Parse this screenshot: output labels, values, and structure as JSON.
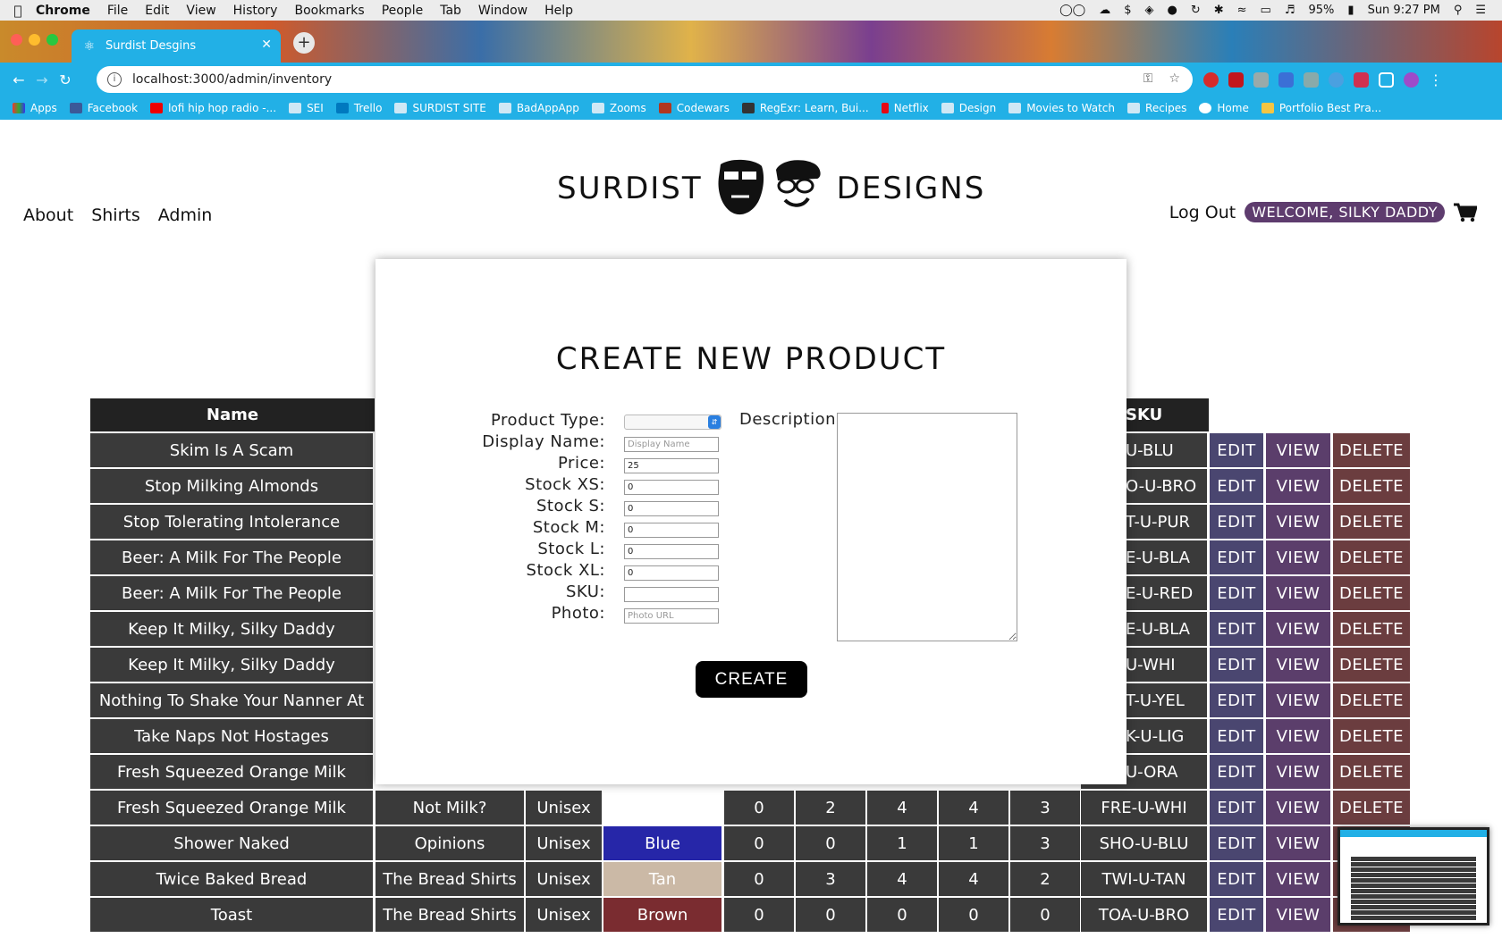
{
  "mac_menu": {
    "app": "Chrome",
    "items": [
      "File",
      "Edit",
      "View",
      "History",
      "Bookmarks",
      "People",
      "Tab",
      "Window",
      "Help"
    ],
    "battery": "95%",
    "clock": "Sun 9:27 PM"
  },
  "browser": {
    "tab_title": "Surdist Desgins",
    "url": "localhost:3000/admin/inventory",
    "bookmarks": [
      "Apps",
      "Facebook",
      "lofi hip hop radio -...",
      "SEI",
      "Trello",
      "SURDIST SITE",
      "BadAppApp",
      "Zooms",
      "Codewars",
      "RegExr: Learn, Bui...",
      "Netflix",
      "Design",
      "Movies to Watch",
      "Recipes",
      "Home",
      "Portfolio Best Pra..."
    ]
  },
  "site": {
    "brand_left": "SURDIST",
    "brand_right": "DESIGNS",
    "nav": [
      "About",
      "Shirts",
      "Admin"
    ],
    "logout": "Log Out",
    "welcome": "WELCOME, SILKY DADDY"
  },
  "table": {
    "header_name": "Name",
    "header_sku": "SKU",
    "action_labels": {
      "edit": "EDIT",
      "view": "VIEW",
      "delete": "DELETE"
    },
    "rows": [
      {
        "name": "Skim Is A Scam",
        "sku": "U-BLU"
      },
      {
        "name": "Stop Milking Almonds",
        "sku": "O-U-BRO"
      },
      {
        "name": "Stop Tolerating Intolerance",
        "sku": "T-U-PUR"
      },
      {
        "name": "Beer: A Milk For The People",
        "sku": "E-U-BLA"
      },
      {
        "name": "Beer: A Milk For The People",
        "sku": "E-U-RED"
      },
      {
        "name": "Keep It Milky, Silky Daddy",
        "sku": "E-U-BLA"
      },
      {
        "name": "Keep It Milky, Silky Daddy",
        "sku": "U-WHI"
      },
      {
        "name": "Nothing To Shake Your Nanner At",
        "sku": "T-U-YEL"
      },
      {
        "name": "Take Naps Not Hostages",
        "sku": "K-U-LIG"
      },
      {
        "name": "Fresh Squeezed Orange Milk",
        "sku": "U-ORA"
      },
      {
        "name": "Fresh Squeezed Orange Milk",
        "label": "Not Milk?",
        "type": "Unisex",
        "color": "",
        "color_hex": "#ffffff",
        "xs": "0",
        "s": "2",
        "m": "4",
        "l": "4",
        "xl": "3",
        "sku": "FRE-U-WHI"
      },
      {
        "name": "Shower Naked",
        "label": "Opinions",
        "type": "Unisex",
        "color": "Blue",
        "color_hex": "#2626a8",
        "xs": "0",
        "s": "0",
        "m": "1",
        "l": "1",
        "xl": "3",
        "sku": "SHO-U-BLU"
      },
      {
        "name": "Twice Baked Bread",
        "label": "The Bread Shirts",
        "type": "Unisex",
        "color": "Tan",
        "color_hex": "#cbb9a6",
        "xs": "0",
        "s": "3",
        "m": "4",
        "l": "4",
        "xl": "2",
        "sku": "TWI-U-TAN"
      },
      {
        "name": "Toast",
        "label": "The Bread Shirts",
        "type": "Unisex",
        "color": "Brown",
        "color_hex": "#7a2c30",
        "xs": "0",
        "s": "0",
        "m": "0",
        "l": "0",
        "xl": "0",
        "sku": "TOA-U-BRO"
      }
    ]
  },
  "modal": {
    "title": "CREATE NEW PRODUCT",
    "labels": {
      "type": "Product Type:",
      "display": "Display Name:",
      "price": "Price:",
      "xs": "Stock XS:",
      "s": "Stock S:",
      "m": "Stock M:",
      "l": "Stock L:",
      "xl": "Stock XL:",
      "sku": "SKU:",
      "photo": "Photo:",
      "description": "Description:"
    },
    "placeholders": {
      "display": "Display Name",
      "photo": "Photo URL"
    },
    "values": {
      "price": "25",
      "xs": "0",
      "s": "0",
      "m": "0",
      "l": "0",
      "xl": "0"
    },
    "create": "CREATE"
  }
}
